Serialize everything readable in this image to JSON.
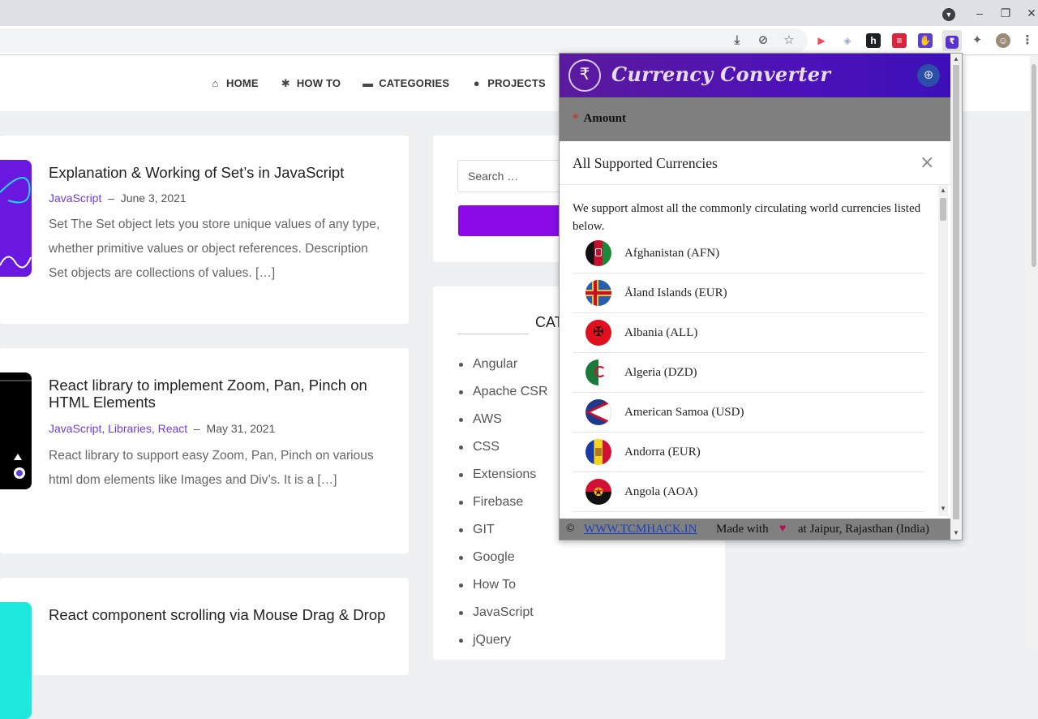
{
  "browser": {
    "window_controls": [
      "▼",
      "–",
      "❐",
      "✕"
    ],
    "toolbar_icons": [
      {
        "name": "download-icon",
        "glyph": "⤓"
      },
      {
        "name": "eye-off-icon",
        "glyph": "⊘"
      },
      {
        "name": "star-icon",
        "glyph": "☆"
      },
      {
        "name": "ext-red-arrow-icon",
        "glyph": "▶",
        "color": "#f04a5a"
      },
      {
        "name": "ext-shield-icon",
        "glyph": "◈",
        "color": "#9aa6c0"
      },
      {
        "name": "ext-h-icon",
        "glyph": "h",
        "color": "#202124"
      },
      {
        "name": "ext-stripes-icon",
        "glyph": "≡",
        "color": "#d7263d"
      },
      {
        "name": "ext-hand-icon",
        "glyph": "✋",
        "color": "#5b3fd6"
      },
      {
        "name": "ext-currency-icon",
        "glyph": "₹",
        "color": "#5a2fd0"
      },
      {
        "name": "puzzle-icon",
        "glyph": "✦",
        "color": "#5f6368"
      },
      {
        "name": "profile-avatar",
        "glyph": "☺",
        "color": "#9c8b78"
      },
      {
        "name": "menu-icon",
        "glyph": "⋮",
        "color": "#5f6368"
      }
    ]
  },
  "site": {
    "nav": [
      {
        "label": "HOME",
        "icon": "⌂"
      },
      {
        "label": "HOW TO",
        "icon": "✱"
      },
      {
        "label": "CATEGORIES",
        "icon": "▬"
      },
      {
        "label": "PROJECTS",
        "icon": "●"
      },
      {
        "label": "",
        "icon": "ℹ"
      }
    ],
    "posts": [
      {
        "title": "Explanation & Working of Set’s in JavaScript",
        "categories": "JavaScript",
        "date": "June 3, 2021",
        "excerpt": "Set The Set object lets you store unique values of any type, whether primitive values or object references. Description Set objects are collections of values. […]",
        "thumb_color": "#6a18e0"
      },
      {
        "title": "React library to implement Zoom, Pan, Pinch on HTML Elements",
        "categories": "JavaScript, Libraries, React",
        "date": "May 31, 2021",
        "excerpt": "React library to support easy Zoom, Pan, Pinch on various html dom elements like Images and Div’s. It is a […]",
        "thumb_color": "#000000"
      },
      {
        "title": "React component scrolling via Mouse Drag & Drop",
        "categories": "",
        "date": "",
        "excerpt": "",
        "thumb_color": "#1ee8dc"
      }
    ],
    "search": {
      "placeholder": "Search …"
    },
    "categories_heading": "CAT",
    "categories": [
      "Angular",
      "Apache CSR",
      "AWS",
      "CSS",
      "Extensions",
      "Firebase",
      "GIT",
      "Google",
      "How To",
      "JavaScript",
      "jQuery"
    ]
  },
  "popup": {
    "title": "Currency Converter",
    "amount_label": "Amount",
    "required_mark": "*",
    "modal": {
      "title": "All Supported Currencies",
      "close": "×",
      "description": "We support almost all the commonly circulating world currencies listed below.",
      "currencies": [
        {
          "name": "Afghanistan (AFN)",
          "flag": "afghanistan"
        },
        {
          "name": "Åland Islands (EUR)",
          "flag": "aland"
        },
        {
          "name": "Albania (ALL)",
          "flag": "albania"
        },
        {
          "name": "Algeria (DZD)",
          "flag": "algeria"
        },
        {
          "name": "American Samoa (USD)",
          "flag": "samoa"
        },
        {
          "name": "Andorra (EUR)",
          "flag": "andorra"
        },
        {
          "name": "Angola (AOA)",
          "flag": "angola"
        }
      ]
    },
    "footer": {
      "copyright": "©",
      "link": "WWW.TCMHACK.IN",
      "made_with": "Made with",
      "heart": "♥",
      "location": "at Jaipur, Rajasthan (India)"
    }
  }
}
